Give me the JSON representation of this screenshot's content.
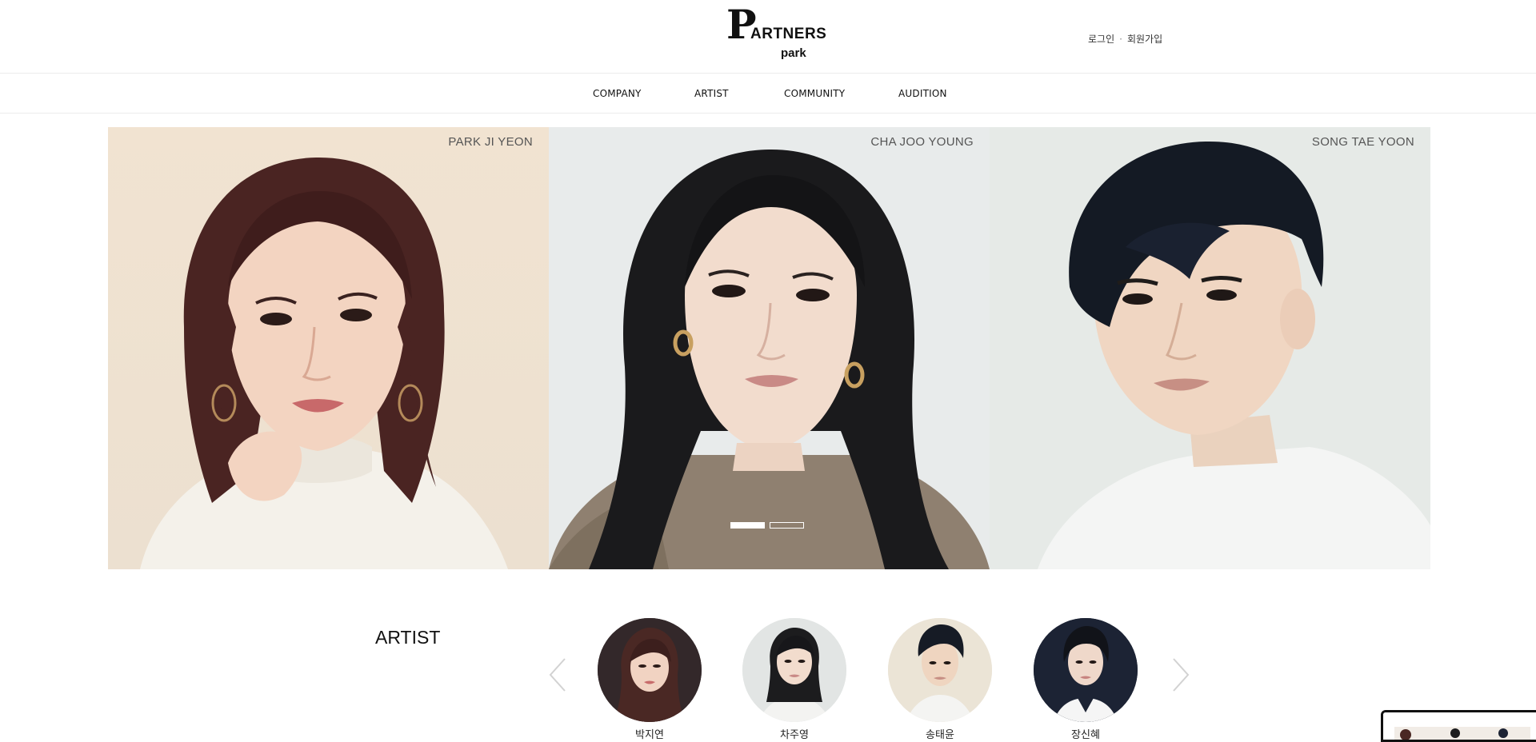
{
  "header": {
    "logo": {
      "initial": "P",
      "word": "ARTNERS",
      "sub": "park"
    },
    "login": "로그인",
    "separator": "·",
    "signup": "회원가입"
  },
  "nav": {
    "items": [
      {
        "label": "COMPANY"
      },
      {
        "label": "ARTIST"
      },
      {
        "label": "COMMUNITY"
      },
      {
        "label": "AUDITION"
      }
    ]
  },
  "hero": {
    "panels": [
      {
        "name": "PARK JI YEON"
      },
      {
        "name": "CHA JOO YOUNG"
      },
      {
        "name": "SONG TAE YOON"
      }
    ],
    "slide_count": 2,
    "active_slide": 1
  },
  "artist": {
    "title": "ARTIST",
    "thumbs": [
      {
        "name": "박지연"
      },
      {
        "name": "차주영"
      },
      {
        "name": "송태윤"
      },
      {
        "name": "장신혜"
      }
    ]
  },
  "colors": {
    "accent": "#111111",
    "panel1_bg": "#efe2d2",
    "panel2_bg": "#e9ecec",
    "panel3_bg": "#e7ebe8"
  }
}
